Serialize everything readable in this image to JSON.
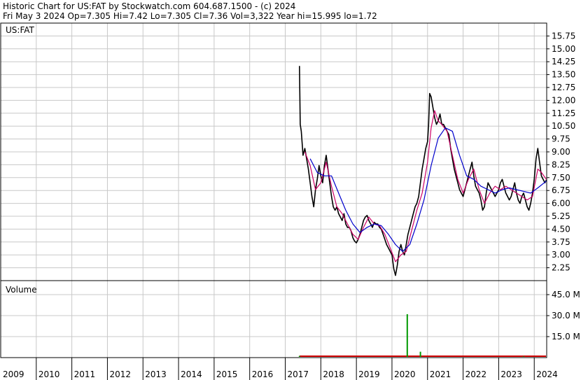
{
  "header": {
    "line1": "Historic Chart for US:FAT by Stockwatch.com 604.687.1500 - (c) 2024",
    "line2": "Fri May  3 2024   Op=7.305   Hi=7.42   Lo=7.305   Cl=7.36   Vol=3,322   Year hi=15.995   lo=1.72"
  },
  "chart_data": [
    {
      "type": "line",
      "title": "",
      "symbol_label": "US:FAT",
      "ylabel": "",
      "ylim": [
        1.5,
        16.5
      ],
      "yticks": [
        "15.75",
        "15.00",
        "14.25",
        "13.50",
        "12.75",
        "12.00",
        "11.25",
        "10.50",
        "9.75",
        "9.00",
        "8.25",
        "7.50",
        "6.75",
        "6.00",
        "5.25",
        "4.50",
        "3.75",
        "3.00",
        "2.25"
      ],
      "xlim": [
        2009.0,
        2024.35
      ],
      "xtick_labels": [
        "2009",
        "2010",
        "2011",
        "2012",
        "2013",
        "2014",
        "2015",
        "2016",
        "2017",
        "2018",
        "2019",
        "2020",
        "2021",
        "2022",
        "2023",
        "2024"
      ],
      "grid": true,
      "colors": {
        "price": "#000000",
        "ma_short": "#cc0066",
        "ma_long": "#0000cc"
      },
      "series": [
        {
          "key": "price",
          "x": [
            2017.4,
            2017.42,
            2017.45,
            2017.5,
            2017.55,
            2017.6,
            2017.65,
            2017.7,
            2017.75,
            2017.8,
            2017.85,
            2017.9,
            2017.95,
            2018.0,
            2018.05,
            2018.1,
            2018.15,
            2018.2,
            2018.25,
            2018.3,
            2018.35,
            2018.4,
            2018.45,
            2018.5,
            2018.55,
            2018.6,
            2018.65,
            2018.7,
            2018.75,
            2018.8,
            2018.85,
            2018.9,
            2018.95,
            2019.0,
            2019.05,
            2019.1,
            2019.15,
            2019.2,
            2019.25,
            2019.3,
            2019.35,
            2019.4,
            2019.45,
            2019.5,
            2019.55,
            2019.6,
            2019.65,
            2019.7,
            2019.75,
            2019.8,
            2019.85,
            2019.9,
            2019.95,
            2020.0,
            2020.05,
            2020.1,
            2020.15,
            2020.2,
            2020.25,
            2020.3,
            2020.35,
            2020.4,
            2020.45,
            2020.5,
            2020.55,
            2020.6,
            2020.65,
            2020.7,
            2020.75,
            2020.8,
            2020.85,
            2020.9,
            2020.95,
            2021.0,
            2021.03,
            2021.06,
            2021.1,
            2021.15,
            2021.2,
            2021.25,
            2021.3,
            2021.35,
            2021.4,
            2021.45,
            2021.5,
            2021.55,
            2021.6,
            2021.65,
            2021.7,
            2021.75,
            2021.8,
            2021.85,
            2021.9,
            2021.95,
            2022.0,
            2022.05,
            2022.1,
            2022.15,
            2022.2,
            2022.25,
            2022.3,
            2022.35,
            2022.4,
            2022.45,
            2022.5,
            2022.55,
            2022.6,
            2022.65,
            2022.7,
            2022.75,
            2022.8,
            2022.85,
            2022.9,
            2022.95,
            2023.0,
            2023.05,
            2023.1,
            2023.15,
            2023.2,
            2023.25,
            2023.3,
            2023.35,
            2023.4,
            2023.45,
            2023.5,
            2023.55,
            2023.6,
            2023.65,
            2023.7,
            2023.75,
            2023.8,
            2023.85,
            2023.9,
            2023.95,
            2024.0,
            2024.05,
            2024.1,
            2024.15,
            2024.2,
            2024.25,
            2024.3,
            2024.34
          ],
          "values": [
            14.0,
            10.6,
            10.2,
            8.8,
            9.2,
            8.6,
            8.0,
            7.2,
            6.4,
            5.8,
            6.8,
            7.4,
            8.2,
            7.6,
            7.2,
            8.2,
            8.8,
            8.0,
            7.2,
            6.4,
            5.8,
            5.6,
            5.8,
            5.4,
            5.2,
            5.0,
            5.4,
            4.8,
            4.6,
            4.6,
            4.4,
            4.0,
            3.8,
            3.7,
            3.9,
            4.2,
            4.6,
            5.0,
            5.2,
            5.3,
            5.0,
            4.8,
            4.6,
            4.9,
            4.8,
            4.8,
            4.6,
            4.5,
            4.2,
            3.9,
            3.6,
            3.4,
            3.2,
            3.0,
            2.2,
            1.8,
            2.4,
            3.2,
            3.6,
            3.2,
            3.0,
            3.6,
            4.2,
            4.6,
            5.0,
            5.4,
            5.8,
            6.0,
            6.4,
            7.2,
            8.0,
            8.6,
            9.2,
            9.6,
            10.6,
            12.4,
            12.2,
            11.6,
            11.0,
            10.6,
            10.8,
            11.2,
            10.6,
            10.6,
            10.4,
            10.2,
            10.0,
            9.2,
            8.6,
            8.0,
            7.6,
            7.2,
            6.8,
            6.6,
            6.4,
            6.8,
            7.2,
            7.6,
            8.0,
            8.4,
            7.6,
            7.0,
            6.8,
            6.6,
            6.2,
            5.6,
            5.8,
            6.6,
            7.2,
            7.0,
            6.8,
            6.6,
            6.4,
            6.6,
            6.8,
            7.2,
            7.4,
            7.0,
            6.6,
            6.4,
            6.2,
            6.4,
            6.8,
            7.2,
            6.6,
            6.2,
            6.0,
            6.4,
            6.6,
            6.2,
            5.8,
            5.6,
            6.0,
            6.6,
            7.4,
            8.6,
            9.2,
            8.4,
            7.6,
            7.4,
            7.2,
            7.36
          ]
        },
        {
          "key": "ma_short",
          "x": [
            2017.55,
            2017.7,
            2017.85,
            2018.0,
            2018.15,
            2018.3,
            2018.45,
            2018.6,
            2018.75,
            2018.9,
            2019.05,
            2019.2,
            2019.35,
            2019.5,
            2019.65,
            2019.8,
            2019.95,
            2020.1,
            2020.25,
            2020.4,
            2020.55,
            2020.7,
            2020.85,
            2021.0,
            2021.1,
            2021.2,
            2021.3,
            2021.4,
            2021.55,
            2021.7,
            2021.85,
            2022.0,
            2022.15,
            2022.3,
            2022.45,
            2022.6,
            2022.75,
            2022.9,
            2023.05,
            2023.2,
            2023.35,
            2023.5,
            2023.65,
            2023.8,
            2023.95,
            2024.1,
            2024.2,
            2024.34
          ],
          "values": [
            9.0,
            8.2,
            6.8,
            7.2,
            8.4,
            7.0,
            5.8,
            5.4,
            4.8,
            4.2,
            3.9,
            4.6,
            5.2,
            4.8,
            4.7,
            4.2,
            3.4,
            2.6,
            3.0,
            3.2,
            4.4,
            5.6,
            6.6,
            8.4,
            10.4,
            11.4,
            10.8,
            10.6,
            10.2,
            8.8,
            7.4,
            6.6,
            7.4,
            8.0,
            6.8,
            6.0,
            6.6,
            7.0,
            6.8,
            7.0,
            6.8,
            6.6,
            6.4,
            6.2,
            6.4,
            8.0,
            7.8,
            7.4
          ]
        },
        {
          "key": "ma_long",
          "x": [
            2017.7,
            2017.9,
            2018.1,
            2018.3,
            2018.5,
            2018.7,
            2018.9,
            2019.1,
            2019.3,
            2019.5,
            2019.7,
            2019.9,
            2020.1,
            2020.3,
            2020.5,
            2020.7,
            2020.9,
            2021.1,
            2021.3,
            2021.5,
            2021.7,
            2021.9,
            2022.1,
            2022.3,
            2022.5,
            2022.7,
            2022.9,
            2023.1,
            2023.3,
            2023.5,
            2023.7,
            2023.9,
            2024.1,
            2024.34
          ],
          "values": [
            8.6,
            7.8,
            7.6,
            7.6,
            6.6,
            5.6,
            4.8,
            4.3,
            4.6,
            4.8,
            4.7,
            4.2,
            3.6,
            3.2,
            3.6,
            4.8,
            6.2,
            8.2,
            9.8,
            10.4,
            10.2,
            8.8,
            7.6,
            7.4,
            7.0,
            6.8,
            6.6,
            6.8,
            6.9,
            6.8,
            6.7,
            6.6,
            6.9,
            7.3
          ]
        }
      ]
    },
    {
      "type": "bar",
      "title": "",
      "panel_label": "Volume",
      "ylim": [
        0,
        55
      ],
      "yticks": [
        "45.0 M",
        "30.0 M",
        "15.0 M"
      ],
      "xlim": [
        2009.0,
        2024.35
      ],
      "grid": true,
      "colors": {
        "up": "#009900",
        "down": "#cc0000"
      },
      "spikes": [
        {
          "x": 2017.4,
          "value": 1.2,
          "color": "#009900"
        },
        {
          "x": 2020.43,
          "value": 31.0,
          "color": "#009900"
        },
        {
          "x": 2020.8,
          "value": 4.2,
          "color": "#009900"
        },
        {
          "x": 2021.05,
          "value": 1.5,
          "color": "#cc0000"
        },
        {
          "x": 2022.4,
          "value": 1.0,
          "color": "#cc0000"
        },
        {
          "x": 2023.7,
          "value": 0.9,
          "color": "#009900"
        }
      ]
    }
  ]
}
